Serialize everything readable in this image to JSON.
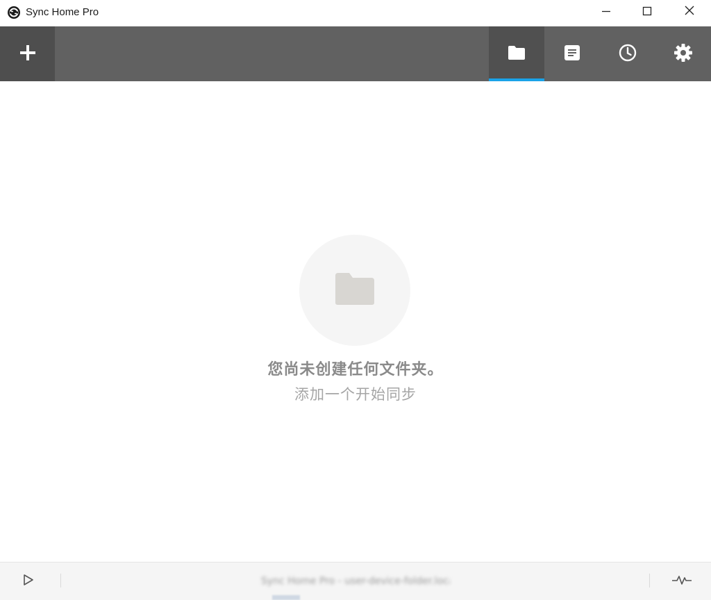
{
  "window": {
    "title": "Sync Home Pro",
    "app_icon": "sync-logo-icon",
    "controls": {
      "minimize": "minimize-icon",
      "maximize": "maximize-icon",
      "close": "close-icon"
    }
  },
  "toolbar": {
    "add_icon": "plus-icon",
    "tabs": [
      {
        "icon": "folder-icon",
        "active": true
      },
      {
        "icon": "document-icon",
        "active": false
      },
      {
        "icon": "clock-icon",
        "active": false
      },
      {
        "icon": "gear-icon",
        "active": false
      }
    ],
    "active_accent": "#1aa3e8"
  },
  "empty_state": {
    "icon": "folder-icon",
    "title": "您尚未创建任何文件夹。",
    "subtitle": "添加一个开始同步"
  },
  "statusbar": {
    "play_icon": "play-icon",
    "status_text": "Sync Home Pro - user-device-folder.local",
    "activity_icon": "activity-icon"
  },
  "colors": {
    "toolbar_bg": "#616161",
    "active_tab_bg": "#505050",
    "accent": "#1aa3e8",
    "empty_title": "#8a8a8a",
    "empty_subtitle": "#a5a5a5"
  }
}
